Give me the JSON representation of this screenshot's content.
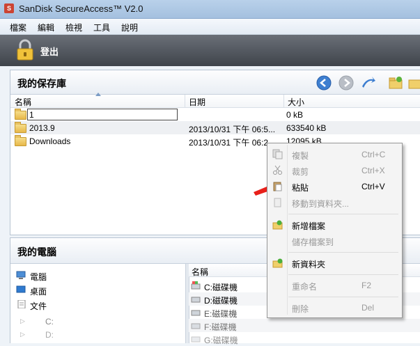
{
  "window": {
    "title": "SanDisk SecureAccess™ V2.0"
  },
  "menu": [
    "檔案",
    "編輯",
    "檢視",
    "工具",
    "說明"
  ],
  "logout": {
    "label": "登出"
  },
  "vault": {
    "title": "我的保存庫",
    "columns": {
      "name": "名稱",
      "date": "日期",
      "size": "大小"
    },
    "rows": [
      {
        "name": "1",
        "date": "",
        "size": "0 kB"
      },
      {
        "name": "2013.9",
        "date": "2013/10/31 下午 06:5...",
        "size": "633540 kB"
      },
      {
        "name": "Downloads",
        "date": "2013/10/31 下午 06:2...",
        "size": "12095 kB"
      }
    ]
  },
  "computer": {
    "title": "我的電腦",
    "tree": [
      "電腦",
      "桌面",
      "文件",
      "C:",
      "D:"
    ],
    "list_header": "名稱",
    "drives": [
      "C:磁碟機",
      "D:磁碟機",
      "E:磁碟機",
      "F:磁碟機",
      "G:磁碟機"
    ]
  },
  "context_menu": {
    "items": [
      {
        "label": "複製",
        "shortcut": "Ctrl+C",
        "enabled": false,
        "icon": "copy-icon"
      },
      {
        "label": "裁剪",
        "shortcut": "Ctrl+X",
        "enabled": false,
        "icon": "scissors-icon"
      },
      {
        "label": "粘貼",
        "shortcut": "Ctrl+V",
        "enabled": true,
        "icon": "paste-icon"
      },
      {
        "label": "移動到資料夾...",
        "shortcut": "",
        "enabled": false,
        "icon": "move-icon"
      },
      {
        "label": "新增檔案",
        "shortcut": "",
        "enabled": true,
        "icon": "add-file-icon"
      },
      {
        "label": "儲存檔案到",
        "shortcut": "",
        "enabled": false,
        "icon": ""
      },
      {
        "label": "新資料夾",
        "shortcut": "",
        "enabled": true,
        "icon": "new-folder-icon"
      },
      {
        "label": "重命名",
        "shortcut": "F2",
        "enabled": false,
        "icon": ""
      },
      {
        "label": "刪除",
        "shortcut": "Del",
        "enabled": false,
        "icon": ""
      }
    ]
  },
  "colors": {
    "annotation_arrow": "#e8201a",
    "logout_bar": "#4f545b"
  }
}
